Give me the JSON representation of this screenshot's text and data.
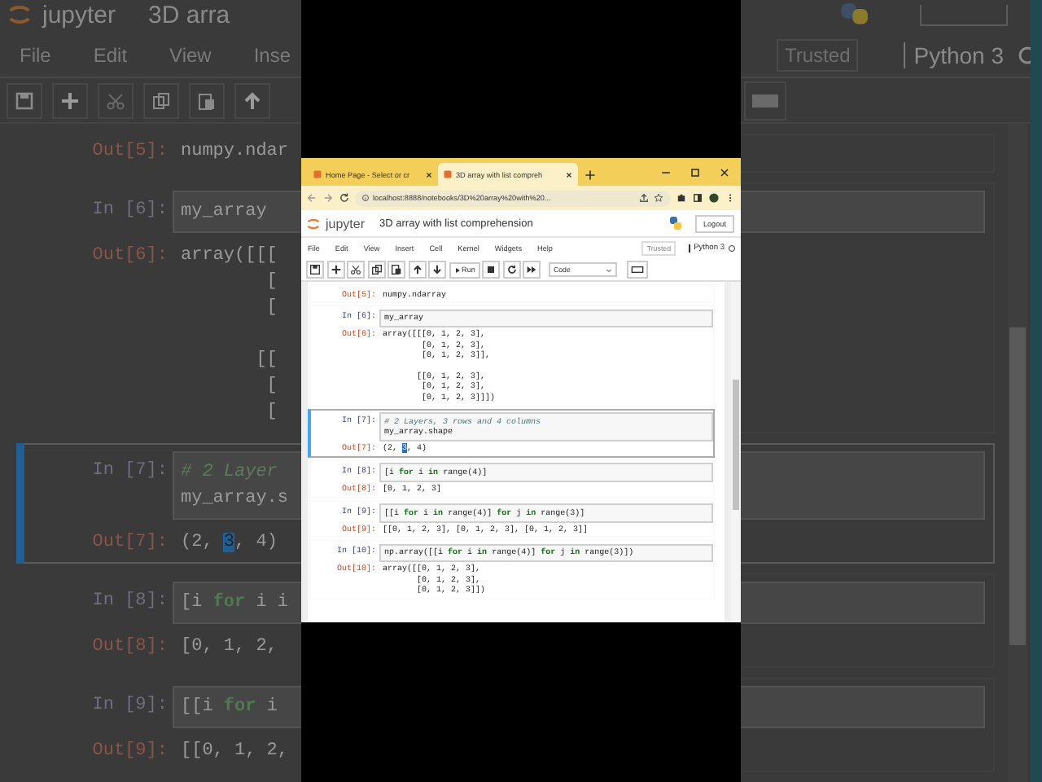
{
  "background": {
    "logo_text": "jupyter",
    "title": "3D arra",
    "menu": [
      "File",
      "Edit",
      "View",
      "Inse"
    ],
    "trusted": "Trusted",
    "kernel": "Python 3",
    "cells": [
      {
        "selected": false,
        "output": {
          "prompt": "Out[5]:",
          "lines": [
            "numpy.ndar"
          ]
        }
      },
      {
        "selected": false,
        "input": {
          "prompt": "In [6]:",
          "lines": [
            "my_array"
          ]
        },
        "output": {
          "prompt": "Out[6]:",
          "blocks": [
            [
              "array([[[",
              "        [",
              "        ["
            ],
            [
              "       [[",
              "        [",
              "        ["
            ]
          ]
        }
      },
      {
        "selected": true,
        "input": {
          "prompt": "In [7]:",
          "comment": "# 2 Layer",
          "lines": [
            "my_array.s"
          ]
        },
        "output": {
          "prompt": "Out[7]:",
          "segments": [
            {
              "text": "(2, ",
              "selected": false
            },
            {
              "text": "3",
              "selected": true
            },
            {
              "text": ", 4)",
              "selected": false
            }
          ]
        }
      },
      {
        "selected": false,
        "input": {
          "prompt": "In [8]:",
          "lines": [
            "[i **for** i i"
          ]
        },
        "output": {
          "prompt": "Out[8]:",
          "lines": [
            "[0, 1, 2,"
          ]
        }
      },
      {
        "selected": false,
        "input": {
          "prompt": "In [9]:",
          "lines": [
            "[[i **for** i"
          ]
        },
        "output": {
          "prompt": "Out[9]:",
          "lines": [
            "[[0, 1, 2,"
          ]
        }
      }
    ]
  },
  "browser": {
    "tabs": [
      {
        "title": "Home Page - Select or cr",
        "selected": false
      },
      {
        "title": "3D array with list compreh",
        "selected": true
      }
    ],
    "url": "localhost:8888/notebooks/3D%20array%20with%20..."
  },
  "notebook": {
    "logo_text": "jupyter",
    "title": "3D array with list comprehension",
    "logout": "Logout",
    "menu": [
      "File",
      "Edit",
      "View",
      "Insert",
      "Cell",
      "Kernel",
      "Widgets",
      "Help"
    ],
    "trusted": "Trusted",
    "kernel": "Python 3",
    "run": "Run",
    "cell_type": "Code",
    "cells": [
      {
        "selected": false,
        "output": {
          "prompt": "Out[5]:",
          "lines": [
            "numpy.ndarray"
          ]
        }
      },
      {
        "selected": false,
        "input": {
          "prompt": "In [6]:",
          "lines": [
            "my_array"
          ]
        },
        "output": {
          "prompt": "Out[6]:",
          "blocks": [
            [
              "array([[[0, 1, 2, 3],",
              "        [0, 1, 2, 3],",
              "        [0, 1, 2, 3]],"
            ],
            [
              "       [[0, 1, 2, 3],",
              "        [0, 1, 2, 3],",
              "        [0, 1, 2, 3]]])"
            ]
          ]
        }
      },
      {
        "selected": true,
        "input": {
          "prompt": "In [7]:",
          "comment": "# 2 Layers, 3 rows and 4 columns",
          "lines": [
            "my_array.shape"
          ]
        },
        "output": {
          "prompt": "Out[7]:",
          "segments": [
            {
              "text": "(2, ",
              "selected": false
            },
            {
              "text": "3",
              "selected": true
            },
            {
              "text": ", 4)",
              "selected": false
            }
          ]
        }
      },
      {
        "selected": false,
        "input": {
          "prompt": "In [8]:",
          "lines": [
            "[i **for** i **in** range(4)]"
          ]
        },
        "output": {
          "prompt": "Out[8]:",
          "lines": [
            "[0, 1, 2, 3]"
          ]
        }
      },
      {
        "selected": false,
        "input": {
          "prompt": "In [9]:",
          "lines": [
            "[[i **for** i **in** range(4)] **for** j **in** range(3)]"
          ]
        },
        "output": {
          "prompt": "Out[9]:",
          "lines": [
            "[[0, 1, 2, 3], [0, 1, 2, 3], [0, 1, 2, 3]]"
          ]
        }
      },
      {
        "selected": false,
        "input": {
          "prompt": "In [10]:",
          "lines": [
            "np.array([[i **for** i **in** range(4)] **for** j **in** range(3)])"
          ]
        },
        "output": {
          "prompt": "Out[10]:",
          "blocks": [
            [
              "array([[0, 1, 2, 3],",
              "       [0, 1, 2, 3],",
              "       [0, 1, 2, 3]])"
            ]
          ]
        }
      }
    ]
  }
}
